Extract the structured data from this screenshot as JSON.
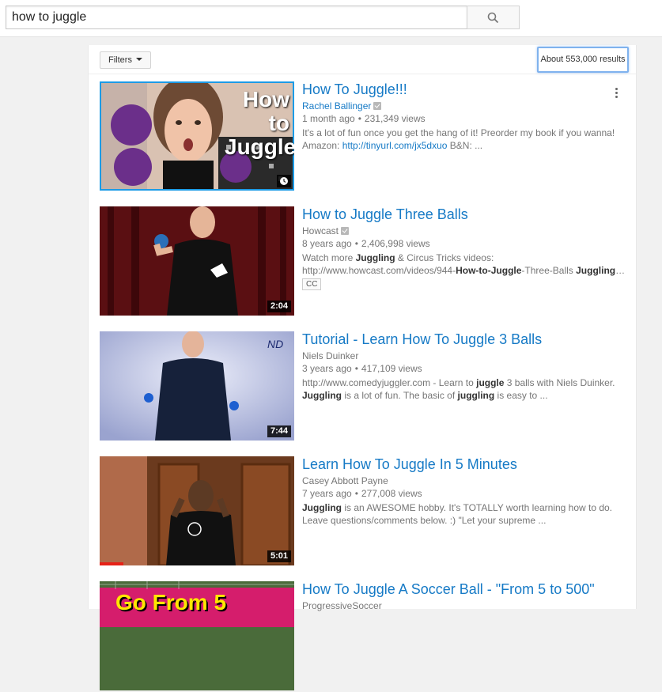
{
  "search": {
    "query": "how to juggle",
    "button_icon": "search-icon"
  },
  "toolbar": {
    "filters_label": "Filters",
    "results_count": "About 553,000 results"
  },
  "results": [
    {
      "title": "How To Juggle!!!",
      "channel": "Rachel Ballinger",
      "verified": true,
      "age": "1 month ago",
      "views": "231,349 views",
      "desc_line1": "It's a lot of fun once you get the hang of it! Preorder my book if you wanna!",
      "desc_line2_prefix": "Amazon: ",
      "desc_line2_link": "http://tinyurl.com/jx5dxuo",
      "desc_line2_suffix": " B&N: ...",
      "overlay_text_1": "How to",
      "overlay_text_2": "Juggle!",
      "watch_later_icon": "clock-icon"
    },
    {
      "title": "How to Juggle Three Balls",
      "channel": "Howcast",
      "verified": true,
      "age": "8 years ago",
      "views": "2,406,998 views",
      "desc_line1": "Watch more Juggling & Circus Tricks videos:",
      "desc_line2": "http://www.howcast.com/videos/944-How-to-Juggle-Three-Balls Juggling…",
      "badge": "CC",
      "duration": "2:04"
    },
    {
      "title": "Tutorial - Learn How To Juggle 3 Balls",
      "channel": "Niels Duinker",
      "verified": false,
      "age": "3 years ago",
      "views": "417,109 views",
      "desc_line1": "http://www.comedyjuggler.com - Learn to juggle 3 balls with Niels Duinker.",
      "desc_line2": "Juggling is a lot of fun. The basic of juggling is easy to ...",
      "duration": "7:44",
      "watermark": "ND"
    },
    {
      "title": "Learn How To Juggle In 5 Minutes",
      "channel": "Casey Abbott Payne",
      "verified": false,
      "age": "7 years ago",
      "views": "277,008 views",
      "desc_line1": "Juggling is an AWESOME hobby. It's TOTALLY worth learning how to do.",
      "desc_line2": "Leave questions/comments below. :) \"Let your supreme ...",
      "duration": "5:01",
      "watch_progress": 0.12
    },
    {
      "title": "How To Juggle A Soccer Ball - \"From 5 to 500\"",
      "channel": "ProgressiveSoccer",
      "overlay_text": "Go From 5"
    }
  ],
  "colors": {
    "link": "#167ac6",
    "selected_outline": "#1c9be6",
    "progress": "#e62117"
  }
}
